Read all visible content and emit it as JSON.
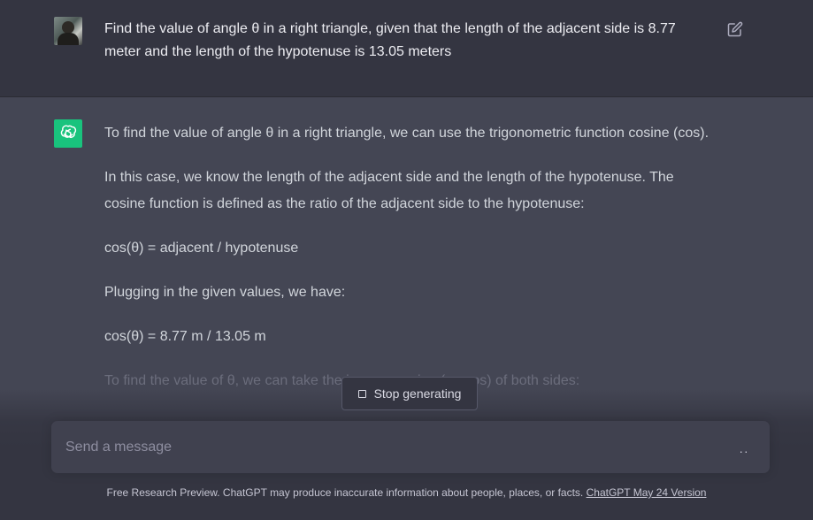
{
  "user_message": {
    "text": "Find the value of angle θ in a right triangle, given that the length of the adjacent side is 8.77 meter and the length of the hypotenuse is 13.05 meters",
    "avatar_icon": "user-photo-avatar",
    "edit_icon": "edit-icon"
  },
  "assistant_message": {
    "avatar_icon": "openai-logo-icon",
    "avatar_color": "#19c37d",
    "paragraphs": [
      "To find the value of angle θ in a right triangle, we can use the trigonometric function cosine (cos).",
      "In this case, we know the length of the adjacent side and the length of the hypotenuse. The cosine function is defined as the ratio of the adjacent side to the hypotenuse:",
      "cos(θ) = adjacent / hypotenuse",
      "Plugging in the given values, we have:",
      "cos(θ) = 8.77 m / 13.05 m",
      "To find the value of θ, we can take the inverse cosine (arccos) of both sides:"
    ]
  },
  "stop_button": {
    "label": "Stop generating",
    "icon": "stop-square-icon"
  },
  "composer": {
    "placeholder": "Send a message",
    "status_indicator": "··"
  },
  "footer": {
    "text": "Free Research Preview. ChatGPT may produce inaccurate information about people, places, or facts. ",
    "link": "ChatGPT May 24 Version"
  },
  "colors": {
    "background": "#343541",
    "assistant_background": "#444654",
    "input_background": "#40414f",
    "accent": "#19c37d"
  }
}
